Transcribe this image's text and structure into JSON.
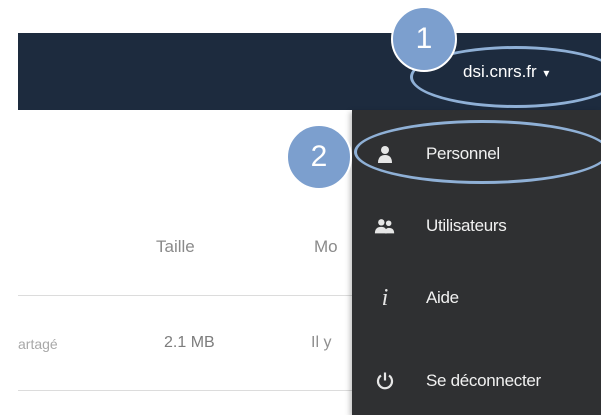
{
  "header": {
    "account_label": "dsi.cnrs.fr",
    "caret": "▾"
  },
  "table": {
    "columns": [
      "Taille",
      "Mo"
    ],
    "row": {
      "share": "artagé",
      "size": "2.1 MB",
      "modified": "Il y"
    }
  },
  "menu": {
    "items": [
      {
        "label": "Personnel",
        "icon": "user-icon"
      },
      {
        "label": "Utilisateurs",
        "icon": "users-icon"
      },
      {
        "label": "Aide",
        "icon": "info-icon"
      },
      {
        "label": "Se déconnecter",
        "icon": "power-icon"
      }
    ]
  },
  "callouts": {
    "first": "1",
    "second": "2"
  },
  "colors": {
    "header_bg": "#1d2b3e",
    "menu_bg": "#2f3032",
    "callout_fill": "#7c9fce",
    "callout_ring": "#8fb0d6"
  }
}
